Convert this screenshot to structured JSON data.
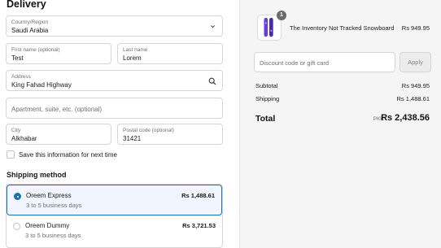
{
  "delivery": {
    "heading": "Delivery",
    "country": {
      "label": "Country/Region",
      "value": "Saudi Arabia"
    },
    "first_name": {
      "label": "First name (optional)",
      "value": "Test"
    },
    "last_name": {
      "label": "Last name",
      "value": "Lorem"
    },
    "address": {
      "label": "Address",
      "value": "King Fahad Highway"
    },
    "apartment": {
      "placeholder": "Apartment, suite, etc. (optional)"
    },
    "city": {
      "label": "City",
      "value": "Alkhabar"
    },
    "postal_code": {
      "label": "Postal code (optional)",
      "value": "31421"
    },
    "save_info_label": "Save this information for next time"
  },
  "shipping": {
    "title": "Shipping method",
    "options": [
      {
        "name": "Oreem Express",
        "subtitle": "3 to 5 business days",
        "price": "Rs 1,488.61",
        "selected": true
      },
      {
        "name": "Oreem Dummy",
        "subtitle": "3 to 5 business days",
        "price": "Rs 3,721.53",
        "selected": false
      }
    ]
  },
  "summary": {
    "product": {
      "name": "The Inventory Not Tracked Snowboard",
      "price": "Rs 949.95",
      "quantity": "1"
    },
    "discount": {
      "placeholder": "Discount code or gift card",
      "apply_label": "Apply"
    },
    "subtotal": {
      "label": "Subtotal",
      "value": "Rs 949.95"
    },
    "shipping": {
      "label": "Shipping",
      "value": "Rs 1,488.61"
    },
    "total": {
      "label": "Total",
      "currency": "PKR",
      "value": "Rs 2,438.56"
    }
  },
  "colors": {
    "accent": "#1773b0",
    "panel_bg": "#f5f5f5",
    "snowboard_purple": "#6b3fd6"
  }
}
